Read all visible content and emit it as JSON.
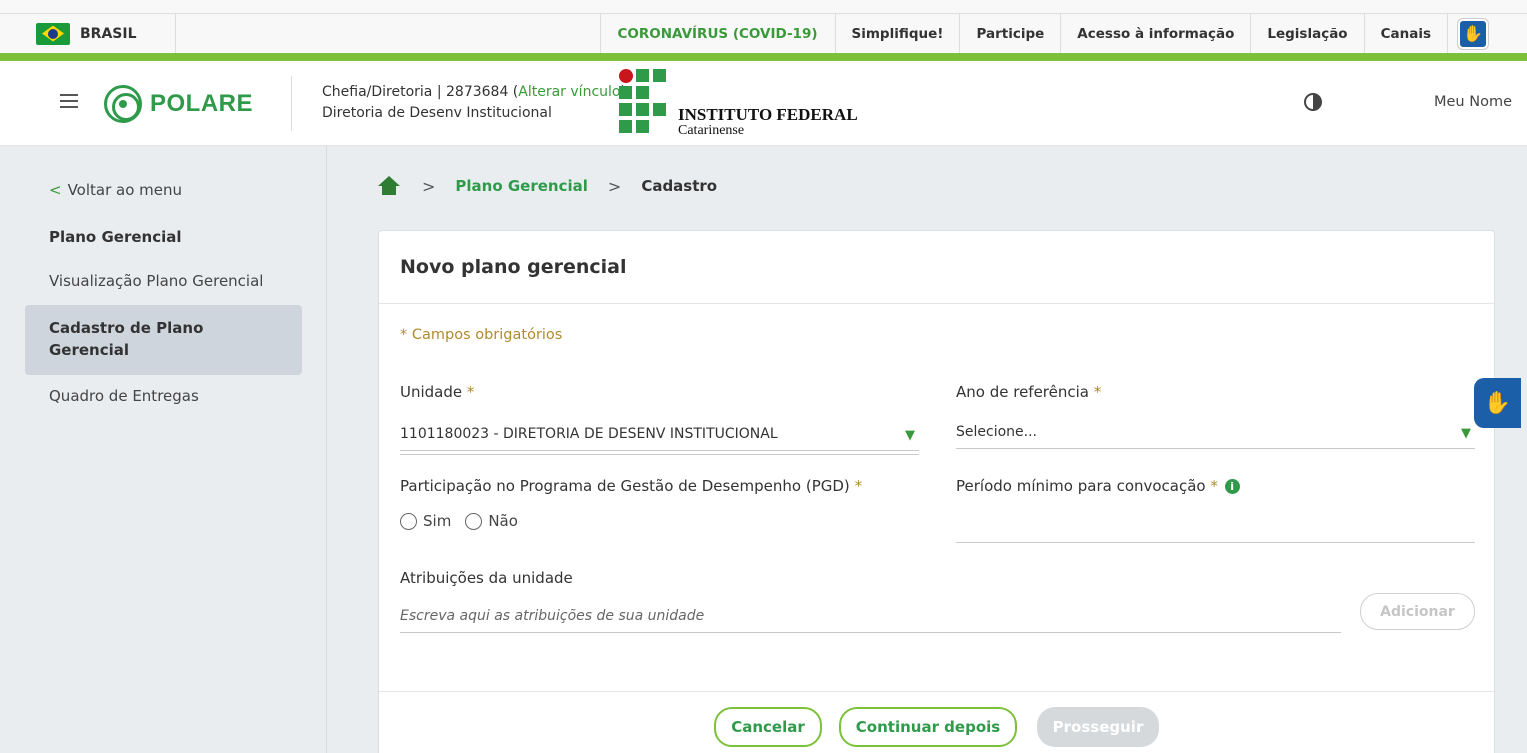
{
  "govbar": {
    "brasil": "BRASIL",
    "links": [
      "CORONAVÍRUS (COVID-19)",
      "Simplifique!",
      "Participe",
      "Acesso à informação",
      "Legislação",
      "Canais"
    ]
  },
  "header": {
    "logo": "POLARE",
    "chefia_line": "Chefia/Diretoria |  2873684  (",
    "alterar": "Alterar vínculo",
    "close_paren": ")",
    "diretoria": "Diretoria de Desenv Institucional",
    "institute_line1": "INSTITUTO FEDERAL",
    "institute_line2": "Catarinense",
    "user": "Meu Nome"
  },
  "sidebar": {
    "back": "Voltar ao menu",
    "section_title": "Plano Gerencial",
    "item_visualizacao": "Visualização Plano Gerencial",
    "item_cadastro": "Cadastro de Plano Gerencial",
    "item_quadro": "Quadro de Entregas"
  },
  "breadcrumb": {
    "link": "Plano Gerencial",
    "current": "Cadastro"
  },
  "form": {
    "title": "Novo plano gerencial",
    "required_note": "* Campos obrigatórios",
    "unidade_label": "Unidade",
    "unidade_value": "1101180023 - DIRETORIA DE DESENV INSTITUCIONAL",
    "ano_label": "Ano de referência",
    "ano_placeholder": "Selecione...",
    "pgd_label": "Participação no Programa de Gestão de Desempenho (PGD)",
    "pgd_sim": "Sim",
    "pgd_nao": "Não",
    "periodo_label": "Período mínimo para convocação",
    "atribuicoes_label": "Atribuições da unidade",
    "atribuicoes_placeholder": "Escreva aqui as atribuições de sua unidade",
    "asterisk": "*",
    "info": "i"
  },
  "buttons": {
    "adicionar": "Adicionar",
    "cancelar": "Cancelar",
    "continuar": "Continuar depois",
    "prosseguir": "Prosseguir"
  },
  "icons": {
    "menu": "hamburger-icon",
    "contrast": "contrast-icon",
    "accessibility": "sign-language-icon",
    "home": "home-icon"
  },
  "colors": {
    "accent_green": "#2f9b4a",
    "bar_green": "#7dc13b",
    "required_gold": "#b08a2e",
    "vlibras_blue": "#1b5fa8"
  }
}
